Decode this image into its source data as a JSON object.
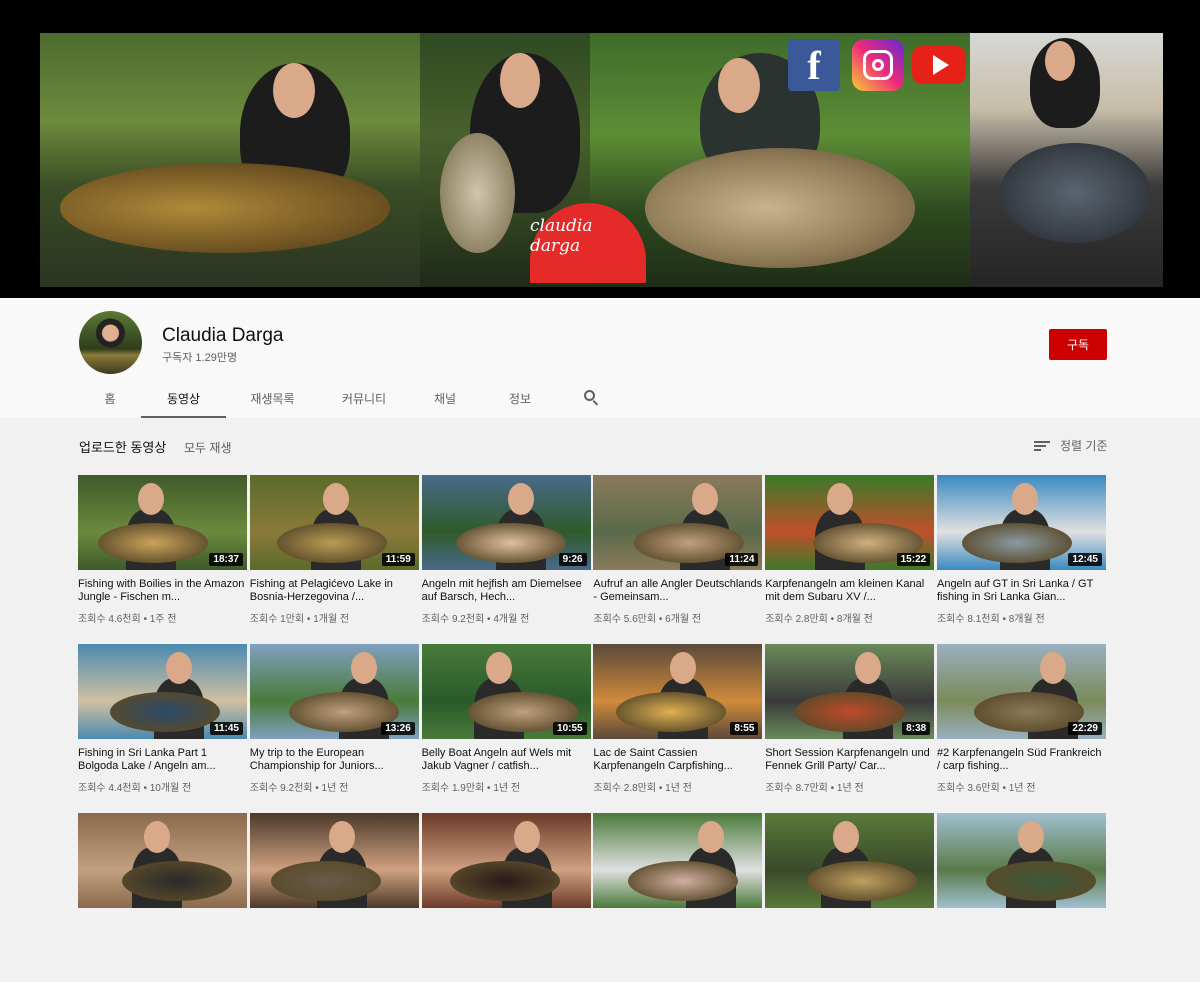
{
  "banner": {
    "logo_text": "claudia darga",
    "social": [
      "facebook-icon",
      "instagram-icon",
      "youtube-icon"
    ]
  },
  "channel": {
    "name": "Claudia Darga",
    "subscribers": "구독자 1.29만명",
    "subscribe_label": "구독"
  },
  "tabs": [
    {
      "label": "홈"
    },
    {
      "label": "동영상"
    },
    {
      "label": "재생목록"
    },
    {
      "label": "커뮤니티"
    },
    {
      "label": "채널"
    },
    {
      "label": "정보"
    }
  ],
  "section": {
    "title": "업로드한 동영상",
    "play_all": "모두 재생",
    "sort_label": "정렬 기준"
  },
  "videos": [
    {
      "title": "Fishing with Boilies in the Amazon Jungle - Fischen m...",
      "duration": "18:37",
      "meta": "조회수 4.6천회 • 1주 전"
    },
    {
      "title": "Fishing at Pelagićevo Lake in Bosnia-Herzegovina /...",
      "duration": "11:59",
      "meta": "조회수 1만회 • 1개월 전"
    },
    {
      "title": "Angeln mit hejfish am Diemelsee auf Barsch, Hech...",
      "duration": "9:26",
      "meta": "조회수 9.2천회 • 4개월 전"
    },
    {
      "title": "Aufruf an alle Angler Deutschlands - Gemeinsam...",
      "duration": "11:24",
      "meta": "조회수 5.6만회 • 6개월 전"
    },
    {
      "title": "Karpfenangeln am kleinen Kanal mit dem Subaru XV /...",
      "duration": "15:22",
      "meta": "조회수 2.8만회 • 8개월 전"
    },
    {
      "title": "Angeln auf GT in Sri Lanka / GT fishing in Sri Lanka Gian...",
      "duration": "12:45",
      "meta": "조회수 8.1천회 • 8개월 전"
    },
    {
      "title": "Fishing in Sri Lanka Part 1 Bolgoda Lake / Angeln am...",
      "duration": "11:45",
      "meta": "조회수 4.4천회 • 10개월 전"
    },
    {
      "title": "My trip to the European Championship for Juniors...",
      "duration": "13:26",
      "meta": "조회수 9.2천회 • 1년 전"
    },
    {
      "title": "Belly Boat Angeln auf Wels mit Jakub Vagner / catfish...",
      "duration": "10:55",
      "meta": "조회수 1.9만회 • 1년 전"
    },
    {
      "title": "Lac de Saint Cassien Karpfenangeln Carpfishing...",
      "duration": "8:55",
      "meta": "조회수 2.8만회 • 1년 전"
    },
    {
      "title": "Short Session Karpfenangeln und Fennek Grill Party/ Car...",
      "duration": "8:38",
      "meta": "조회수 8.7만회 • 1년 전"
    },
    {
      "title": "#2 Karpfenangeln Süd Frankreich / carp fishing...",
      "duration": "22:29",
      "meta": "조회수 3.6만회 • 1년 전"
    },
    {
      "title": "",
      "duration": "",
      "meta": ""
    },
    {
      "title": "",
      "duration": "",
      "meta": ""
    },
    {
      "title": "",
      "duration": "",
      "meta": ""
    },
    {
      "title": "",
      "duration": "",
      "meta": ""
    },
    {
      "title": "",
      "duration": "",
      "meta": ""
    },
    {
      "title": "",
      "duration": "",
      "meta": ""
    }
  ],
  "colors": {
    "subscribe": "#cc0000",
    "page_bg": "#f1f1f1",
    "header_bg": "#f9f9f9"
  }
}
